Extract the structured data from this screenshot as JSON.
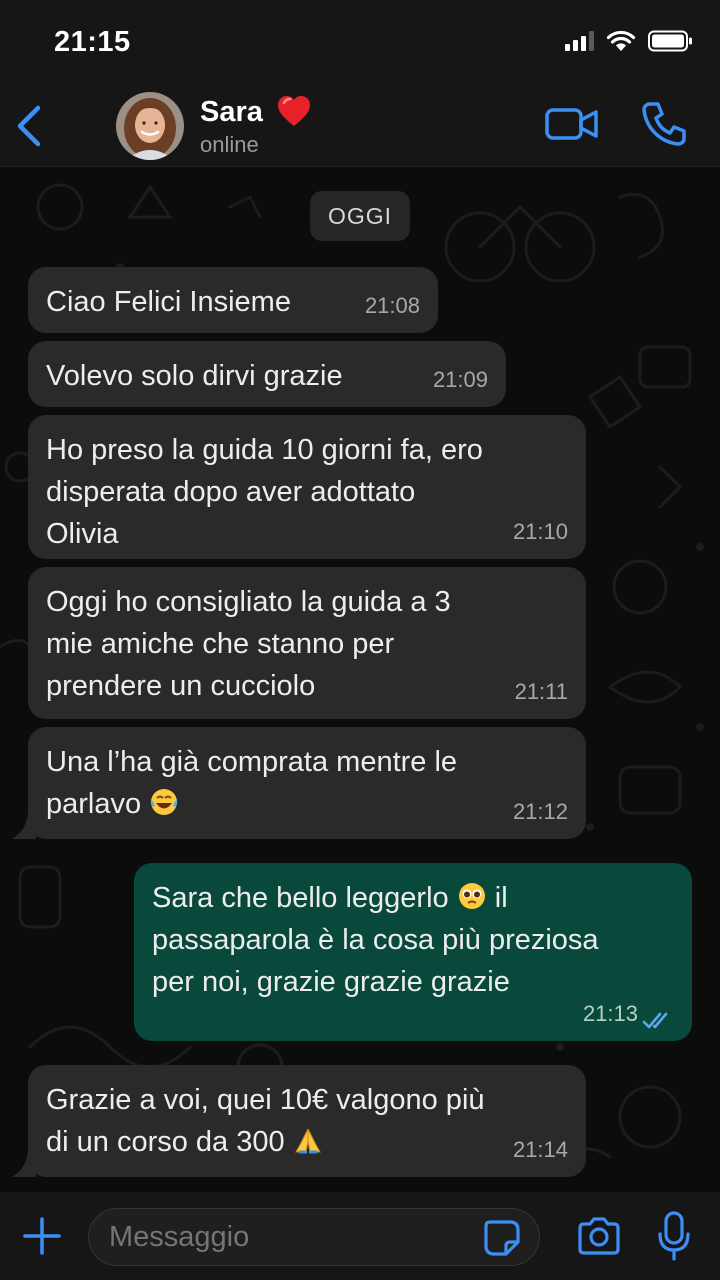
{
  "status_bar": {
    "time": "21:15"
  },
  "header": {
    "contact_name": "Sara",
    "contact_status": "online"
  },
  "chat": {
    "date_label": "OGGI",
    "messages": [
      {
        "direction": "in",
        "text": "Ciao Felici Insieme",
        "time": "21:08"
      },
      {
        "direction": "in",
        "text": "Volevo solo dirvi grazie",
        "time": "21:09"
      },
      {
        "direction": "in",
        "lines": [
          "Ho preso la guida 10 giorni fa, ero",
          "disperata dopo aver adottato",
          "Olivia"
        ],
        "time": "21:10"
      },
      {
        "direction": "in",
        "lines": [
          "Oggi ho consigliato la guida a 3",
          "mie amiche che stanno per",
          "prendere un cucciolo"
        ],
        "time": "21:11"
      },
      {
        "direction": "in",
        "lines": [
          "Una l’ha già comprata mentre le",
          "parlavo"
        ],
        "emoji": "laughing-tears",
        "time": "21:12"
      },
      {
        "direction": "out",
        "lines": [
          "Sara che bello leggerlo",
          "il",
          "passaparola è la cosa più preziosa",
          "per noi, grazie grazie grazie"
        ],
        "emoji": "pleading-face",
        "time": "21:13",
        "status": "read"
      },
      {
        "direction": "in",
        "lines": [
          "Grazie a voi, quei 10€ valgono più",
          "di un corso da 300"
        ],
        "emoji": "folded-hands",
        "time": "21:14"
      }
    ]
  },
  "composer": {
    "placeholder": "Messaggio"
  },
  "colors": {
    "accent": "#3b8ff5",
    "incoming_bubble": "#2a2a2a",
    "outgoing_bubble": "#08493b",
    "read_ticks": "#5aa7f5"
  }
}
